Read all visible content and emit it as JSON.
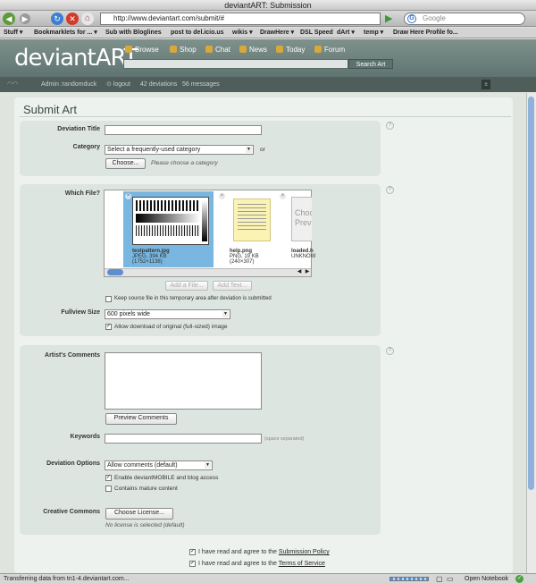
{
  "window": {
    "title": "deviantART: Submission"
  },
  "toolbar": {
    "url": "http://www.deviantart.com/submit/#",
    "search_placeholder": "Google"
  },
  "bookmarks": [
    "Stuff ▾",
    "Bookmarklets for ... ▾",
    "Sub with Bloglines",
    "post to del.icio.us",
    "wikis ▾",
    "DrawHere ▾",
    "DSL Speed",
    "dArt ▾",
    "temp ▾",
    "Draw Here Profile fo..."
  ],
  "da": {
    "logo": "deviantART",
    "nav": [
      "Browse",
      "Shop",
      "Chat",
      "News",
      "Today",
      "Forum"
    ],
    "search_button": "Search Art",
    "user": "Admin :randomduck",
    "logout": "logout",
    "deviations": "42 deviations",
    "messages": "56 messages"
  },
  "page": {
    "title": "Submit Art"
  },
  "form": {
    "deviation_title_label": "Deviation Title",
    "category_label": "Category",
    "category_value": "Select a frequently-used category",
    "or": "or",
    "choose_button": "Choose...",
    "choose_note": "Please choose a category",
    "which_file_label": "Which File?",
    "files": [
      {
        "name": "testpattern.jpg",
        "meta1": "JPEG, 394 KB",
        "meta2": "(1752×1138)"
      },
      {
        "name": "help.png",
        "meta1": "PNG, 19 KB",
        "meta2": "(240×307)"
      },
      {
        "name": "loaded.h",
        "meta1": "UNKNOW",
        "meta2": ""
      }
    ],
    "third_preview": "Choo\nPrev",
    "add_file": "Add a File...",
    "add_text": "Add Text...",
    "keep_source": "Keep source file in this temporary area after deviation is submitted",
    "fullview_label": "Fullview Size",
    "fullview_value": "600 pixels wide",
    "allow_download": "Allow download of original (full-sized) image",
    "artists_comments_label": "Artist's Comments",
    "preview_comments": "Preview Comments",
    "keywords_label": "Keywords",
    "keywords_note": "(space separated)",
    "options_label": "Deviation Options",
    "comments_value": "Allow comments (default)",
    "enable_mobile": "Enable deviantMOBILE and blog access",
    "mature": "Contains mature content",
    "cc_label": "Creative Commons",
    "choose_license": "Choose License...",
    "license_note": "No license is selected (default)",
    "agree1_prefix": "I have read and agree to the",
    "agree1_link": "Submission Policy",
    "agree2_prefix": "I have read and agree to the",
    "agree2_link": "Terms of Service"
  },
  "status": {
    "text": "Transferring data from tn1-4.deviantart.com...",
    "open_notebook": "Open Notebook"
  },
  "help_icon": "?"
}
